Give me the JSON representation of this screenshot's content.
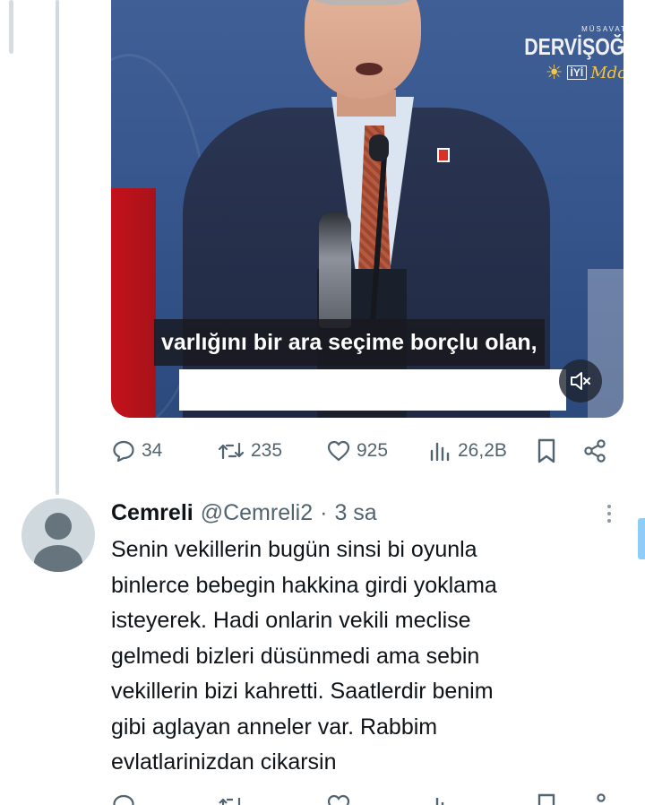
{
  "video": {
    "logo_small": "MÜSAVAT",
    "logo_main": "DERVİŞOĞLU",
    "logo_party": "İYİ",
    "logo_party_sub": "PARTİ",
    "logo_signature": "Mdo",
    "subtitle": "varlığını bir ara seçime borçlu olan,"
  },
  "post_actions": {
    "replies": "34",
    "reposts": "235",
    "likes": "925",
    "views": "26,2B"
  },
  "reply": {
    "display_name": "Cemreli",
    "handle": "@Cemreli2",
    "separator": "·",
    "time": "3 sa",
    "lines": [
      "Senin vekillerin bugün sinsi bi oyunla",
      "binlerce bebegin hakkina girdi yoklama",
      "isteyerek. Hadi onlarin vekili meclise",
      "gelmedi bizleri düsünmedi ama sebin",
      "vekillerin bizi kahretti. Saatlerdir benim",
      "gibi aglayan anneler var. Rabbim",
      "evlatlarinizdan cikarsin"
    ]
  }
}
